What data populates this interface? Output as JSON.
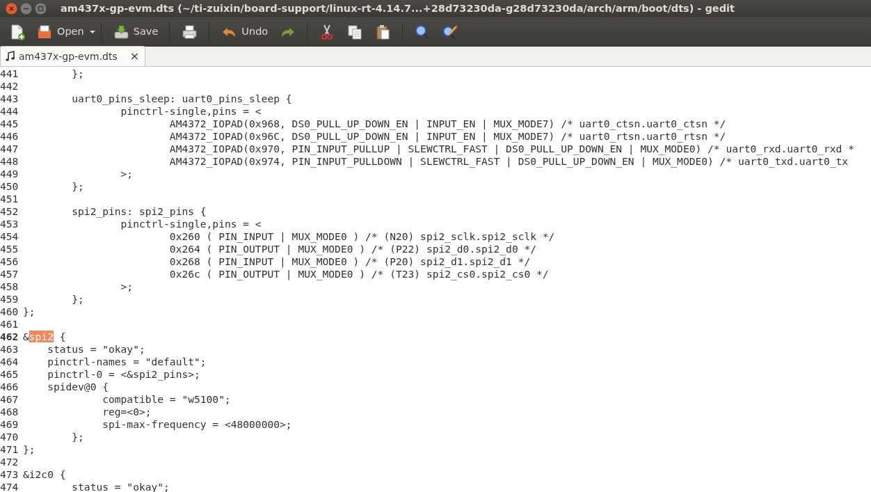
{
  "window": {
    "title": "am437x-gp-evm.dts (~/ti-zuixin/board-support/linux-rt-4.14.7...+28d73230da-g28d73230da/arch/arm/boot/dts) - gedit"
  },
  "toolbar": [
    {
      "kind": "new"
    },
    {
      "kind": "open",
      "label": "Open"
    },
    {
      "kind": "dropdown"
    },
    {
      "kind": "separator"
    },
    {
      "kind": "save",
      "label": "Save"
    },
    {
      "kind": "separator"
    },
    {
      "kind": "print"
    },
    {
      "kind": "separator"
    },
    {
      "kind": "undo",
      "label": "Undo"
    },
    {
      "kind": "redo"
    },
    {
      "kind": "separator"
    },
    {
      "kind": "cut"
    },
    {
      "kind": "copy"
    },
    {
      "kind": "paste"
    },
    {
      "kind": "separator"
    },
    {
      "kind": "find"
    },
    {
      "kind": "replace"
    }
  ],
  "tabs": [
    {
      "label": "am437x-gp-evm.dts",
      "close": "×",
      "selected": true
    }
  ],
  "editor": {
    "lines": [
      {
        "number": "441",
        "current": false,
        "segments": [
          {
            "text": "        };"
          }
        ]
      },
      {
        "number": "442",
        "current": false
      },
      {
        "number": "443",
        "current": false,
        "segments": [
          {
            "text": "        uart0_pins_sleep: uart0_pins_sleep {"
          }
        ]
      },
      {
        "number": "444",
        "current": false,
        "segments": [
          {
            "text": "                pinctrl-single,pins = <"
          }
        ]
      },
      {
        "number": "445",
        "current": false,
        "segments": [
          {
            "text": "                        AM4372_IOPAD(0x968, DS0_PULL_UP_DOWN_EN | INPUT_EN | MUX_MODE7) /* uart0_ctsn.uart0_ctsn */"
          }
        ]
      },
      {
        "number": "446",
        "current": false,
        "segments": [
          {
            "text": "                        AM4372_IOPAD(0x96C, DS0_PULL_UP_DOWN_EN | INPUT_EN | MUX_MODE7) /* uart0_rtsn.uart0_rtsn */"
          }
        ]
      },
      {
        "number": "447",
        "current": false,
        "segments": [
          {
            "text": "                        AM4372_IOPAD(0x970, PIN_INPUT_PULLUP | SLEWCTRL_FAST | DS0_PULL_UP_DOWN_EN | MUX_MODE0) /* uart0_rxd.uart0_rxd *"
          }
        ]
      },
      {
        "number": "448",
        "current": false,
        "segments": [
          {
            "text": "                        AM4372_IOPAD(0x974, PIN_INPUT_PULLDOWN | SLEWCTRL_FAST | DS0_PULL_UP_DOWN_EN | MUX_MODE0) /* uart0_txd.uart0_tx"
          }
        ]
      },
      {
        "number": "449",
        "current": false,
        "segments": [
          {
            "text": "                >;"
          }
        ]
      },
      {
        "number": "450",
        "current": false,
        "segments": [
          {
            "text": "        };"
          }
        ]
      },
      {
        "number": "451",
        "current": false
      },
      {
        "number": "452",
        "current": false,
        "segments": [
          {
            "text": "        spi2_pins: spi2_pins {"
          }
        ]
      },
      {
        "number": "453",
        "current": false,
        "segments": [
          {
            "text": "                pinctrl-single,pins = <"
          }
        ]
      },
      {
        "number": "454",
        "current": false,
        "segments": [
          {
            "text": "                        0x260 ( PIN_INPUT | MUX_MODE0 ) /* (N20) spi2_sclk.spi2_sclk */"
          }
        ]
      },
      {
        "number": "455",
        "current": false,
        "segments": [
          {
            "text": "                        0x264 ( PIN_OUTPUT | MUX_MODE0 ) /* (P22) spi2_d0.spi2_d0 */"
          }
        ]
      },
      {
        "number": "456",
        "current": false,
        "segments": [
          {
            "text": "                        0x268 ( PIN_INPUT | MUX_MODE0 ) /* (P20) spi2_d1.spi2_d1 */"
          }
        ]
      },
      {
        "number": "457",
        "current": false,
        "segments": [
          {
            "text": "                        0x26c ( PIN_OUTPUT | MUX_MODE0 ) /* (T23) spi2_cs0.spi2_cs0 */"
          }
        ]
      },
      {
        "number": "458",
        "current": false,
        "segments": [
          {
            "text": "                >;"
          }
        ]
      },
      {
        "number": "459",
        "current": false,
        "segments": [
          {
            "text": "        };"
          }
        ]
      },
      {
        "number": "460",
        "current": false,
        "segments": [
          {
            "text": "};"
          }
        ]
      },
      {
        "number": "461",
        "current": false
      },
      {
        "number": "462",
        "current": true,
        "segments": [
          {
            "text": "&"
          },
          {
            "text": "spi2",
            "highlighted": true
          },
          {
            "text": " {"
          }
        ]
      },
      {
        "number": "463",
        "current": false,
        "segments": [
          {
            "text": "    status = \"okay\";"
          }
        ]
      },
      {
        "number": "464",
        "current": false,
        "segments": [
          {
            "text": "    pinctrl-names = \"default\";"
          }
        ]
      },
      {
        "number": "465",
        "current": false,
        "segments": [
          {
            "text": "    pinctrl-0 = <&spi2_pins>;"
          }
        ]
      },
      {
        "number": "466",
        "current": false,
        "segments": [
          {
            "text": "    spidev@0 {"
          }
        ]
      },
      {
        "number": "467",
        "current": false,
        "segments": [
          {
            "text": "             compatible = \"w5100\";"
          }
        ]
      },
      {
        "number": "468",
        "current": false,
        "segments": [
          {
            "text": "             reg=<0>;"
          }
        ]
      },
      {
        "number": "469",
        "current": false,
        "segments": [
          {
            "text": "             spi-max-frequency = <48000000>;"
          }
        ]
      },
      {
        "number": "470",
        "current": false,
        "segments": [
          {
            "text": "        };"
          }
        ]
      },
      {
        "number": "471",
        "current": false,
        "segments": [
          {
            "text": "};"
          }
        ]
      },
      {
        "number": "472",
        "current": false
      },
      {
        "number": "473",
        "current": false,
        "segments": [
          {
            "text": "&i2c0 {"
          }
        ]
      },
      {
        "number": "474",
        "current": false,
        "segments": [
          {
            "text": "        status = \"okay\";"
          }
        ]
      }
    ]
  }
}
